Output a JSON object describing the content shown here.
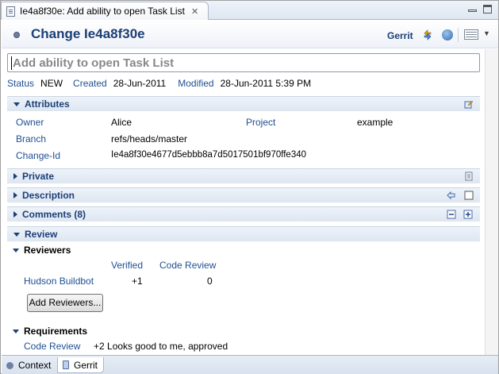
{
  "editor_tab": {
    "title": "Ie4a8f30e: Add ability to open Task List",
    "close": "✕"
  },
  "header": {
    "title": "Change Ie4a8f30e",
    "brand": "Gerrit"
  },
  "summary": {
    "value": "Add ability to open Task List"
  },
  "status": {
    "status_label": "Status",
    "status_value": "NEW",
    "created_label": "Created",
    "created_value": "28-Jun-2011",
    "modified_label": "Modified",
    "modified_value": "28-Jun-2011 5:39 PM"
  },
  "attributes": {
    "title": "Attributes",
    "owner_label": "Owner",
    "owner_value": "Alice",
    "project_label": "Project",
    "project_value": "example",
    "branch_label": "Branch",
    "branch_value": "refs/heads/master",
    "changeid_label": "Change-Id",
    "changeid_value": "Ie4a8f30e4677d5ebbb8a7d5017501bf970ffe340"
  },
  "sections": {
    "private": "Private",
    "description": "Description",
    "comments": "Comments (8)",
    "review": "Review"
  },
  "reviewers": {
    "title": "Reviewers",
    "col_verified": "Verified",
    "col_code_review": "Code Review",
    "rows": [
      {
        "name": "Hudson Buildbot",
        "verified": "+1",
        "code_review": "0"
      }
    ],
    "add_button": "Add Reviewers..."
  },
  "requirements": {
    "title": "Requirements",
    "code_review_label": "Code Review",
    "code_review_value": "+2 Looks good to me, approved"
  },
  "bottom_tabs": {
    "context": "Context",
    "gerrit": "Gerrit"
  },
  "colors": {
    "link_blue": "#1f4f92",
    "title_blue": "#1c3f75"
  }
}
